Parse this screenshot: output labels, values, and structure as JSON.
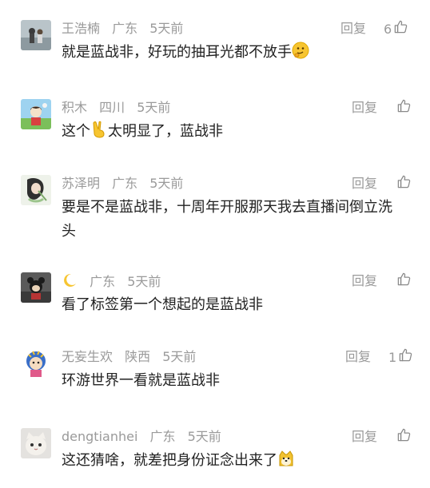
{
  "comments": [
    {
      "username": "王浩楠",
      "location": "广东",
      "time": "5天前",
      "text": "就是蓝战非，好玩的抽耳光都不放手",
      "reply_label": "回复",
      "like_count": "6",
      "emoji": "thinking-face"
    },
    {
      "username": "积木",
      "location": "四川",
      "time": "5天前",
      "text_before": "这个",
      "text_after": "太明显了，蓝战非",
      "reply_label": "回复",
      "like_count": "",
      "emoji": "victory-hand"
    },
    {
      "username": "苏泽明",
      "location": "广东",
      "time": "5天前",
      "text": "要是不是蓝战非，十周年开服那天我去直播间倒立洗头",
      "reply_label": "回复",
      "like_count": ""
    },
    {
      "username": "",
      "location": "广东",
      "time": "5天前",
      "text": "看了标签第一个想起的是蓝战非",
      "reply_label": "回复",
      "like_count": "",
      "username_icon": "crescent-moon"
    },
    {
      "username": "无妄生欢",
      "location": "陕西",
      "time": "5天前",
      "text": "环游世界一看就是蓝战非",
      "reply_label": "回复",
      "like_count": "1"
    },
    {
      "username": "dengtianhei",
      "location": "广东",
      "time": "5天前",
      "text": "这还猜啥，就差把身份证念出来了",
      "reply_label": "回复",
      "like_count": "",
      "emoji": "doge"
    }
  ]
}
